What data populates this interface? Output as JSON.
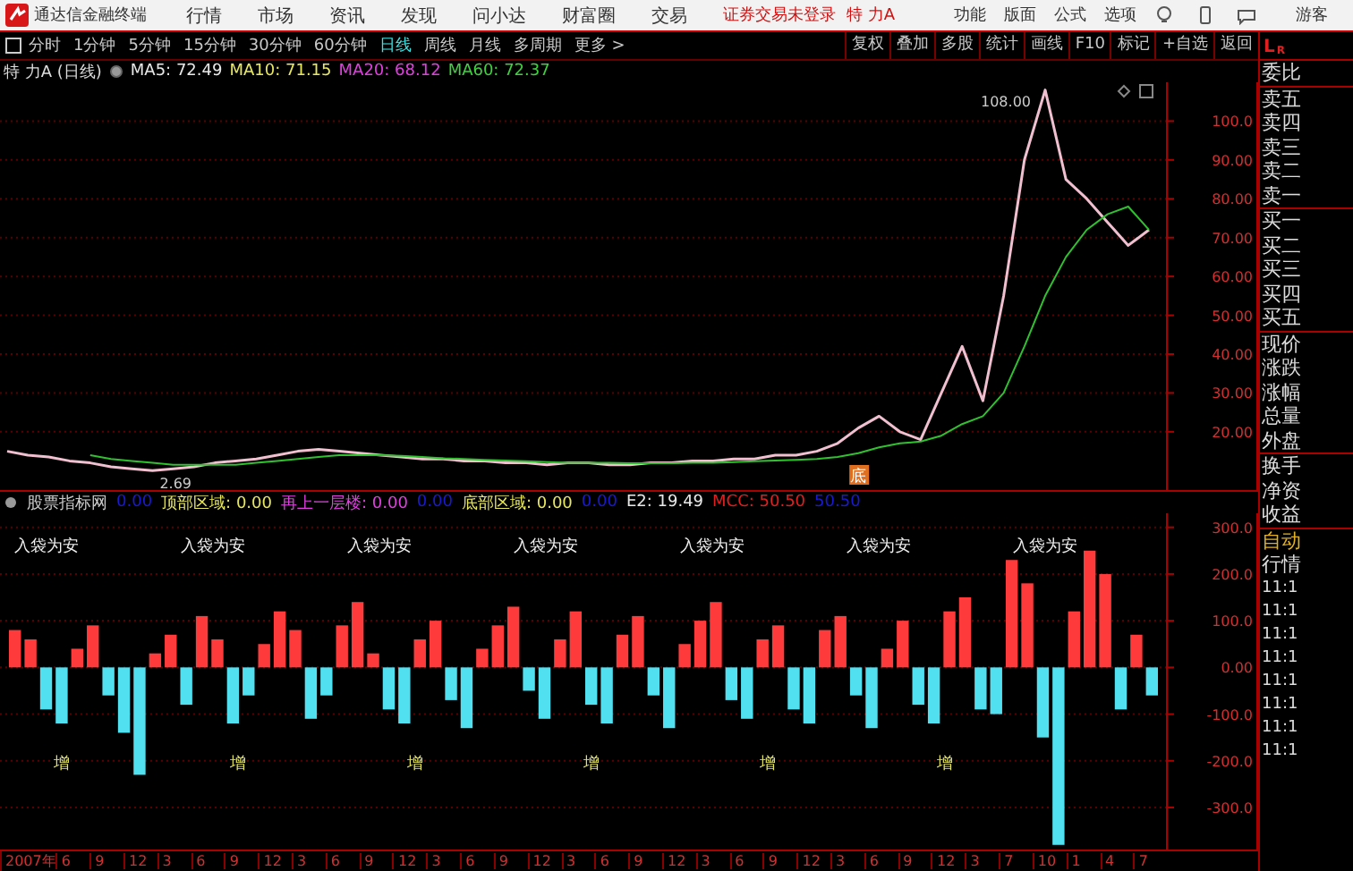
{
  "title_bar": {
    "app_name": "通达信金融终端",
    "menus": [
      "行情",
      "市场",
      "资讯",
      "发现",
      "问小达",
      "财富圈",
      "交易"
    ],
    "login_status": "证券交易未登录",
    "stock_name": "特 力A",
    "right_menus": [
      "功能",
      "版面",
      "公式",
      "选项"
    ],
    "user": "游客"
  },
  "toolbar": {
    "periods": [
      {
        "label": "分时",
        "selected": false
      },
      {
        "label": "1分钟",
        "selected": false
      },
      {
        "label": "5分钟",
        "selected": false
      },
      {
        "label": "15分钟",
        "selected": false
      },
      {
        "label": "30分钟",
        "selected": false
      },
      {
        "label": "60分钟",
        "selected": false
      },
      {
        "label": "日线",
        "selected": true
      },
      {
        "label": "周线",
        "selected": false
      },
      {
        "label": "月线",
        "selected": false
      },
      {
        "label": "多周期",
        "selected": false
      }
    ],
    "more": "更多 >",
    "tools": [
      "复权",
      "叠加",
      "多股",
      "统计",
      "画线",
      "F10",
      "标记",
      "+自选",
      "返回"
    ]
  },
  "legend": {
    "stock": "特 力A (日线)",
    "averages": [
      {
        "text": "MA5: 72.49",
        "color": "#e8e8e8"
      },
      {
        "text": "MA10: 71.15",
        "color": "#e8e860"
      },
      {
        "text": "MA20: 68.12",
        "color": "#e040e0"
      },
      {
        "text": "MA60: 72.37",
        "color": "#40d040"
      }
    ]
  },
  "price_chart": {
    "high_label": "108.00",
    "low_label": "2.69",
    "marker": "底",
    "chart_data": {
      "type": "line",
      "grid": true,
      "ylim": [
        5,
        110
      ],
      "yticks": [
        {
          "value": 20,
          "label": "20.00"
        },
        {
          "value": 30,
          "label": "30.00"
        },
        {
          "value": 40,
          "label": "40.00"
        },
        {
          "value": 50,
          "label": "50.00"
        },
        {
          "value": 60,
          "label": "60.00"
        },
        {
          "value": 70,
          "label": "70.00"
        },
        {
          "value": 80,
          "label": "80.00"
        },
        {
          "value": 90,
          "label": "90.00"
        },
        {
          "value": 100,
          "label": "100.0"
        }
      ],
      "series": [
        {
          "color": "#f0c0d0",
          "values": [
            15,
            14,
            13.5,
            12.5,
            12,
            11,
            10.5,
            10,
            10.5,
            11,
            12,
            12.5,
            13,
            14,
            15,
            15.5,
            15,
            14.5,
            14,
            13.5,
            13,
            13,
            12.5,
            12.5,
            12,
            12,
            11.5,
            12,
            12,
            11.5,
            11.5,
            12,
            12,
            12.5,
            12.5,
            13,
            13,
            14,
            14,
            15,
            17,
            21,
            24,
            20,
            18,
            30,
            42,
            28,
            55,
            90,
            108,
            85,
            80,
            74,
            68,
            72
          ]
        },
        {
          "color": "#30c030",
          "values": [
            null,
            null,
            null,
            null,
            14,
            13,
            12.5,
            12,
            11.5,
            11.5,
            11.5,
            11.5,
            12,
            12.5,
            13,
            13.5,
            14,
            14,
            14,
            13.8,
            13.5,
            13.2,
            13,
            12.8,
            12.6,
            12.4,
            12.2,
            12,
            12,
            12,
            11.9,
            11.9,
            11.9,
            12,
            12,
            12.2,
            12.4,
            12.6,
            12.8,
            13,
            13.5,
            14.5,
            16,
            17,
            17.5,
            19,
            22,
            24,
            30,
            42,
            55,
            65,
            72,
            76,
            78,
            72
          ]
        }
      ]
    }
  },
  "indicator_legend": {
    "name": "股票指标网",
    "items": [
      {
        "text": "0.00",
        "color": "#1a1ad0"
      },
      {
        "text": "顶部区域: 0.00",
        "color": "#e8e860"
      },
      {
        "text": "再上一层楼: 0.00",
        "color": "#e040e0"
      },
      {
        "text": "0.00",
        "color": "#1a1ad0"
      },
      {
        "text": "底部区域: 0.00",
        "color": "#e8e860"
      },
      {
        "text": "0.00",
        "color": "#1a1ad0"
      },
      {
        "text": "E2: 19.49",
        "color": "#e8e8e8"
      },
      {
        "text": "MCC: 50.50",
        "color": "#e02020"
      },
      {
        "text": "50.50",
        "color": "#1a1ad0"
      }
    ]
  },
  "indicator_chart": {
    "chart_data": {
      "type": "bar",
      "grid": true,
      "ylim": [
        -390,
        330
      ],
      "yticks": [
        {
          "value": 300,
          "label": "300.0"
        },
        {
          "value": 200,
          "label": "200.0"
        },
        {
          "value": 100,
          "label": "100.0"
        },
        {
          "value": 0,
          "label": "0.00"
        },
        {
          "value": -100,
          "label": "-100.0"
        },
        {
          "value": -200,
          "label": "-200.0"
        },
        {
          "value": -300,
          "label": "-300.0"
        }
      ],
      "series": [
        {
          "color": "#ff3a3a",
          "values": [
            80,
            60,
            null,
            null,
            40,
            90,
            null,
            null,
            null,
            30,
            70,
            null,
            110,
            60,
            null,
            null,
            50,
            120,
            80,
            null,
            null,
            90,
            140,
            30,
            null,
            null,
            60,
            100,
            null,
            null,
            40,
            90,
            130,
            null,
            null,
            60,
            120,
            null,
            null,
            70,
            110,
            null,
            null,
            50,
            100,
            140,
            null,
            null,
            60,
            90,
            null,
            null,
            80,
            110,
            null,
            null,
            40,
            100,
            null,
            null,
            120,
            150,
            null,
            null,
            230,
            180,
            null,
            null,
            120,
            250,
            200,
            null,
            70,
            null
          ]
        },
        {
          "color": "#50e0f0",
          "values": [
            null,
            null,
            -90,
            -120,
            null,
            null,
            -60,
            -140,
            -230,
            null,
            null,
            -80,
            null,
            null,
            -120,
            -60,
            null,
            null,
            null,
            -110,
            -60,
            null,
            null,
            null,
            -90,
            -120,
            null,
            null,
            -70,
            -130,
            null,
            null,
            null,
            -50,
            -110,
            null,
            null,
            -80,
            -120,
            null,
            null,
            -60,
            -130,
            null,
            null,
            null,
            -70,
            -110,
            null,
            null,
            -90,
            -120,
            null,
            null,
            -60,
            -130,
            null,
            null,
            -80,
            -120,
            null,
            null,
            -90,
            -100,
            null,
            null,
            -150,
            -380,
            null,
            null,
            null,
            -90,
            null,
            -60
          ]
        }
      ]
    }
  },
  "exit_signals": [
    "入袋为安",
    "入袋为安",
    "入袋为安",
    "入袋为安",
    "入袋为安",
    "入袋为安",
    "入袋为安"
  ],
  "increase_signals": [
    "增",
    "增",
    "增",
    "增",
    "增",
    "增"
  ],
  "time_axis": [
    "2007年",
    "6",
    "9",
    "12",
    "3",
    "6",
    "9",
    "12",
    "3",
    "6",
    "9",
    "12",
    "3",
    "6",
    "9",
    "12",
    "3",
    "6",
    "9",
    "12",
    "3",
    "6",
    "9",
    "12",
    "3",
    "6",
    "9",
    "12",
    "3",
    "7",
    "10",
    "1",
    "4",
    "7"
  ],
  "quote_panel": {
    "corner": [
      "L",
      "R"
    ],
    "groups": [
      [
        "委比"
      ],
      [
        "卖五",
        "卖四",
        "卖三",
        "卖二",
        "卖一"
      ],
      [
        "买一",
        "买二",
        "买三",
        "买四",
        "买五"
      ],
      [
        "现价",
        "涨跌",
        "涨幅",
        "总量",
        "外盘"
      ],
      [
        "换手",
        "净资",
        "收益"
      ]
    ],
    "auto": "自动",
    "market": "行情",
    "times": [
      "11:1",
      "11:1",
      "11:1",
      "11:1",
      "11:1",
      "11:1",
      "11:1",
      "11:1"
    ]
  }
}
